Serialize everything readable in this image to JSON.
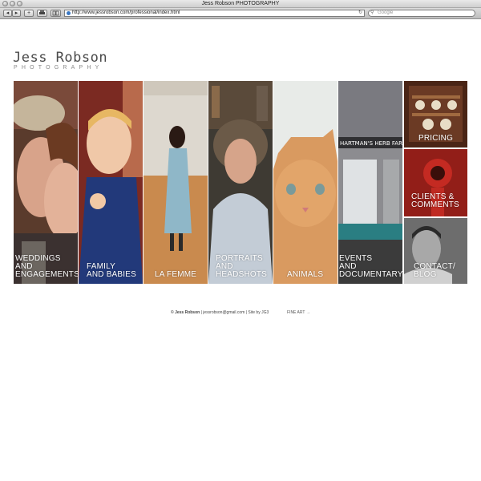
{
  "window": {
    "title": "Jess Robson PHOTOGRAPHY"
  },
  "toolbar": {
    "back_icon": "back-arrow-icon",
    "forward_icon": "forward-arrow-icon",
    "add_icon": "plus-icon",
    "print_icon": "print-icon",
    "bookmark_icon": "book-icon",
    "url": "http://www.jessrobson.com/professional/index.html",
    "search_placeholder": "Google"
  },
  "logo": {
    "name": "Jess Robson",
    "tagline": "PHOTOGRAPHY"
  },
  "gallery": {
    "weddings": "WEDDINGS\nAND\nENGAGEMENTS",
    "family": "FAMILY\nAND BABIES",
    "femme": "LA FEMME",
    "portraits": "PORTRAITS\nAND\nHEADSHOTS",
    "animals": "ANIMALS",
    "events": "EVENTS\nAND\nDOCUMENTARY",
    "pricing": "PRICING",
    "clients": "CLIENTS &\nCOMMENTS",
    "contact": "CONTACT/\nBLOG",
    "sign_text": "HARTMAN'S HERB FARM"
  },
  "footer": {
    "copyright": "© Jess Robson",
    "email": "jessrobson@gmail.com",
    "site_by": "Site by JG3",
    "fine_art": "FINE ART →"
  }
}
